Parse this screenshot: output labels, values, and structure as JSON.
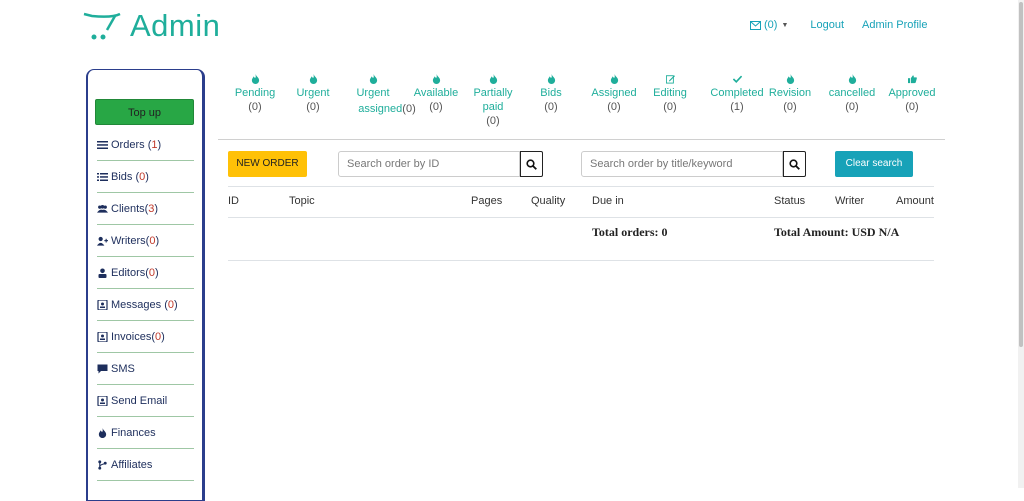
{
  "header": {
    "brand": "Admin",
    "messages_count": "(0)",
    "logout": "Logout",
    "profile": "Admin Profile"
  },
  "colors": {
    "brand": "#1fae9b",
    "sidebar_border": "#2b3e8c",
    "topup": "#28a745",
    "new_order": "#ffc107",
    "clear_search": "#17a2b8",
    "count": "#c0392b"
  },
  "sidebar": {
    "topup_label": "Top up",
    "items": [
      {
        "icon": "list-icon",
        "label": "Orders",
        "count": "1"
      },
      {
        "icon": "checklist-icon",
        "label": "Bids",
        "count": "0"
      },
      {
        "icon": "users-icon",
        "label": "Clients",
        "count": "3"
      },
      {
        "icon": "user-plus-icon",
        "label": "Writers",
        "count": "0"
      },
      {
        "icon": "editor-icon",
        "label": "Editors",
        "count": "0"
      },
      {
        "icon": "contact-book-icon",
        "label": "Messages",
        "count": "0"
      },
      {
        "icon": "contact-book-icon",
        "label": "Invoices",
        "count": "0"
      },
      {
        "icon": "comment-icon",
        "label": "SMS",
        "count": null
      },
      {
        "icon": "contact-book-icon",
        "label": "Send Email",
        "count": null
      },
      {
        "icon": "flame-icon",
        "label": "Finances",
        "count": null
      },
      {
        "icon": "branch-icon",
        "label": "Affiliates",
        "count": null
      }
    ]
  },
  "statuses": [
    {
      "icon": "flame-icon",
      "line1": "Pending",
      "line2": "",
      "count": "(0)"
    },
    {
      "icon": "flame-icon",
      "line1": "Urgent",
      "line2": "",
      "count": "(0)"
    },
    {
      "icon": "flame-icon",
      "line1": "Urgent",
      "line2": "assigned",
      "count": "(0)"
    },
    {
      "icon": "flame-icon",
      "line1": "Available",
      "line2": "",
      "count": "(0)"
    },
    {
      "icon": "flame-icon",
      "line1": "Partially",
      "line2": "paid",
      "count": "(0)"
    },
    {
      "icon": "flame-icon",
      "line1": "Bids",
      "line2": "",
      "count": "(0)"
    },
    {
      "icon": "flame-icon",
      "line1": "Assigned",
      "line2": "",
      "count": "(0)"
    },
    {
      "icon": "edit-icon",
      "line1": "Editing",
      "line2": "",
      "count": "(0)"
    },
    {
      "icon": "check-icon",
      "line1": "Completed",
      "line2": "",
      "count": "(1)"
    },
    {
      "icon": "flame-icon",
      "line1": "Revision",
      "line2": "",
      "count": "(0)"
    },
    {
      "icon": "flame-icon",
      "line1": "cancelled",
      "line2": "",
      "count": "(0)"
    },
    {
      "icon": "thumbs-up-icon",
      "line1": "Approved",
      "line2": "",
      "count": "(0)"
    }
  ],
  "toolbar": {
    "new_order": "NEW ORDER",
    "search_id_placeholder": "Search order by ID",
    "search_title_placeholder": "Search order by title/keyword",
    "clear_search": "Clear search"
  },
  "table": {
    "columns": [
      "ID",
      "Topic",
      "Pages",
      "Quality",
      "Due in",
      "Status",
      "Writer",
      "Amount"
    ],
    "total_orders": "Total orders: 0",
    "total_amount": "Total Amount: USD N/A"
  }
}
